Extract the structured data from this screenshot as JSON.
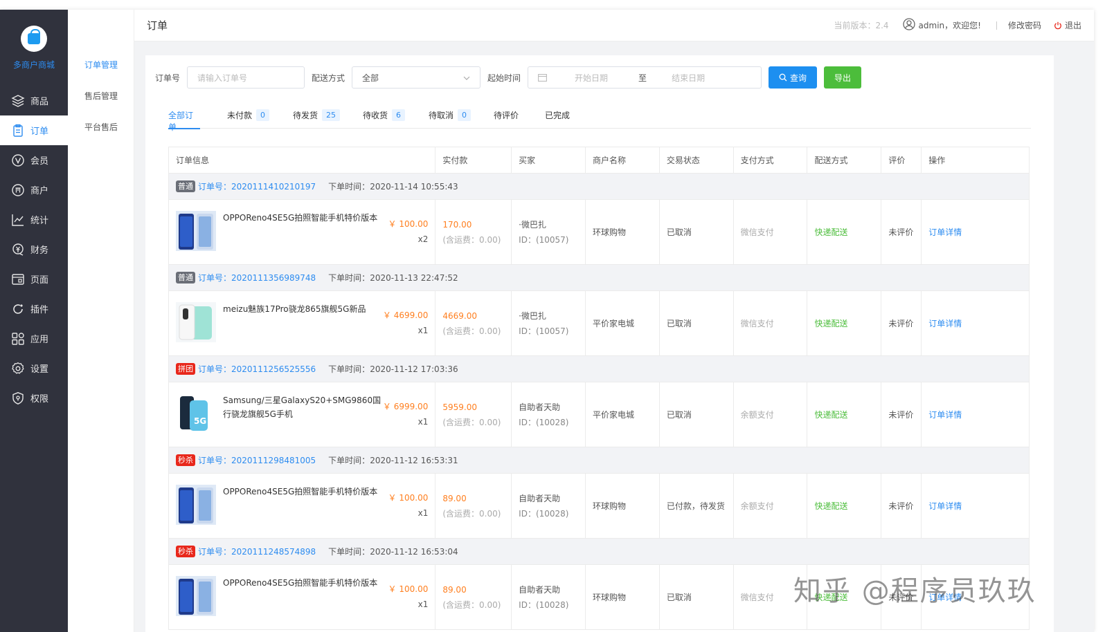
{
  "sidebar": {
    "brand": "多商户商城",
    "items": [
      {
        "label": "商品",
        "icon": "layers-icon"
      },
      {
        "label": "订单",
        "icon": "clipboard-icon",
        "active": true
      },
      {
        "label": "会员",
        "icon": "vip-icon"
      },
      {
        "label": "商户",
        "icon": "merchant-icon"
      },
      {
        "label": "统计",
        "icon": "chart-icon"
      },
      {
        "label": "财务",
        "icon": "finance-icon"
      },
      {
        "label": "页面",
        "icon": "page-icon"
      },
      {
        "label": "插件",
        "icon": "plugin-icon"
      },
      {
        "label": "应用",
        "icon": "apps-icon"
      },
      {
        "label": "设置",
        "icon": "gear-icon"
      },
      {
        "label": "权限",
        "icon": "shield-icon"
      }
    ]
  },
  "submenu": {
    "items": [
      "订单管理",
      "售后管理",
      "平台售后"
    ]
  },
  "header": {
    "title": "订单",
    "version": "当前版本：2.4",
    "welcome": "admin，欢迎您!",
    "change_password": "修改密码",
    "logout": "退出"
  },
  "filters": {
    "order_no_label": "订单号",
    "order_no_placeholder": "请输入订单号",
    "delivery_label": "配送方式",
    "delivery_value": "全部",
    "time_label": "起始时间",
    "start_placeholder": "开始日期",
    "to": "至",
    "end_placeholder": "结束日期",
    "query": "查询",
    "export": "导出"
  },
  "tabs": [
    {
      "label": "全部订单",
      "count": ""
    },
    {
      "label": "未付款",
      "count": "0"
    },
    {
      "label": "待发货",
      "count": "25"
    },
    {
      "label": "待收货",
      "count": "6"
    },
    {
      "label": "待取消",
      "count": "0"
    },
    {
      "label": "待评价",
      "count": ""
    },
    {
      "label": "已完成",
      "count": ""
    }
  ],
  "columns": [
    "订单信息",
    "实付款",
    "买家",
    "商户名称",
    "交易状态",
    "支付方式",
    "配送方式",
    "评价",
    "操作"
  ],
  "order_label": "订单号：",
  "time_prefix": "下单时间：",
  "orders": [
    {
      "tag": "普通",
      "tag_color": "gray",
      "no": "2020111410210197",
      "time": "2020-11-14 10:55:43",
      "product": "OPPOReno4SE5G拍照智能手机特价版本",
      "price": "￥ 100.00",
      "qty": "x2",
      "paid": "170.00",
      "shipping": "(含运费：0.00)",
      "buyer": "·微巴扎",
      "buyer_id": "ID：(10057)",
      "merchant": "环球购物",
      "status": "已取消",
      "pay": "微信支付",
      "delivery": "快递配送",
      "review": "未评价",
      "action": "订单详情",
      "thumb": "phone-blue"
    },
    {
      "tag": "普通",
      "tag_color": "gray",
      "no": "2020111356989748",
      "time": "2020-11-13 22:47:52",
      "product": "meizu魅族17Pro骁龙865旗舰5G新品",
      "price": "￥ 4699.00",
      "qty": "x1",
      "paid": "4669.00",
      "shipping": "(含运费：0.00)",
      "buyer": "·微巴扎",
      "buyer_id": "ID：(10057)",
      "merchant": "平价家电城",
      "status": "已取消",
      "pay": "微信支付",
      "delivery": "快递配送",
      "review": "未评价",
      "action": "订单详情",
      "thumb": "phone-white"
    },
    {
      "tag": "拼团",
      "tag_color": "red",
      "no": "2020111256525556",
      "time": "2020-11-12 17:03:36",
      "product": "Samsung/三星GalaxyS20+SMG9860国行骁龙旗舰5G手机",
      "price": "￥ 6999.00",
      "qty": "x1",
      "paid": "5959.00",
      "shipping": "(含运费：0.00)",
      "buyer": "自助者天助",
      "buyer_id": "ID：(10028)",
      "merchant": "平价家电城",
      "status": "已取消",
      "pay": "余额支付",
      "delivery": "快递配送",
      "review": "未评价",
      "action": "订单详情",
      "thumb": "phone-5g"
    },
    {
      "tag": "秒杀",
      "tag_color": "red",
      "no": "2020111298481005",
      "time": "2020-11-12 16:53:31",
      "product": "OPPOReno4SE5G拍照智能手机特价版本",
      "price": "￥ 100.00",
      "qty": "x1",
      "paid": "89.00",
      "shipping": "(含运费：0.00)",
      "buyer": "自助者天助",
      "buyer_id": "ID：(10028)",
      "merchant": "环球购物",
      "status": "已付款，待发货",
      "pay": "余额支付",
      "delivery": "快递配送",
      "review": "未评价",
      "action": "订单详情",
      "thumb": "phone-blue"
    },
    {
      "tag": "秒杀",
      "tag_color": "red",
      "no": "2020111248574898",
      "time": "2020-11-12 16:53:04",
      "product": "OPPOReno4SE5G拍照智能手机特价版本",
      "price": "￥ 100.00",
      "qty": "x1",
      "paid": "89.00",
      "shipping": "(含运费：0.00)",
      "buyer": "自助者天助",
      "buyer_id": "ID：(10028)",
      "merchant": "环球购物",
      "status": "已取消",
      "pay": "微信支付",
      "delivery": "快递配送",
      "review": "未评价",
      "action": "订单详情",
      "thumb": "phone-blue"
    }
  ],
  "watermark": "知乎 @程序员玖玖"
}
